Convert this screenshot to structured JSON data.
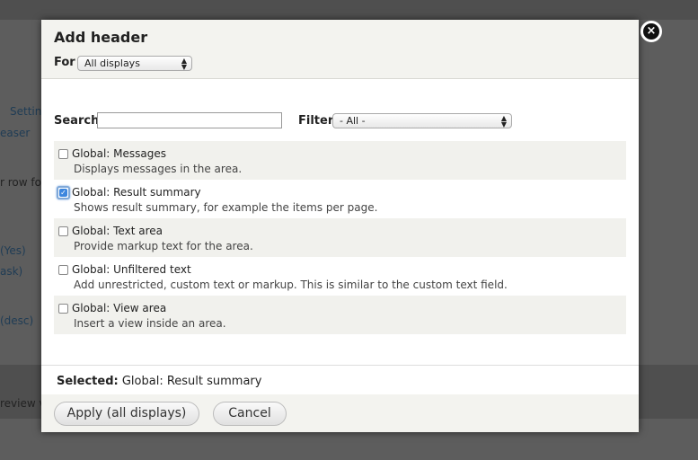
{
  "background": {
    "items": [
      "Settin",
      "easer",
      "r row fo",
      "(Yes)",
      "ask)",
      "(desc)",
      "review v"
    ]
  },
  "dialog": {
    "title": "Add header",
    "for_label": "For",
    "for_select_value": "All displays",
    "close_glyph": "×"
  },
  "search": {
    "label": "Search",
    "value": "",
    "placeholder": ""
  },
  "filter": {
    "label": "Filter",
    "value": "- All -"
  },
  "options": [
    {
      "title": "Global: Messages",
      "description": "Displays messages in the area.",
      "checked": false
    },
    {
      "title": "Global: Result summary",
      "description": "Shows result summary, for example the items per page.",
      "checked": true
    },
    {
      "title": "Global: Text area",
      "description": "Provide markup text for the area.",
      "checked": false
    },
    {
      "title": "Global: Unfiltered text",
      "description": "Add unrestricted, custom text or markup. This is similar to the custom text field.",
      "checked": false
    },
    {
      "title": "Global: View area",
      "description": "Insert a view inside an area.",
      "checked": false
    }
  ],
  "selected": {
    "label": "Selected:",
    "value": "Global: Result summary"
  },
  "buttons": {
    "apply": "Apply (all displays)",
    "cancel": "Cancel"
  },
  "colors": {
    "overlay": "#5d5d5d",
    "header_bg": "#f3f3ef",
    "checkbox_accent": "#3d86de"
  }
}
